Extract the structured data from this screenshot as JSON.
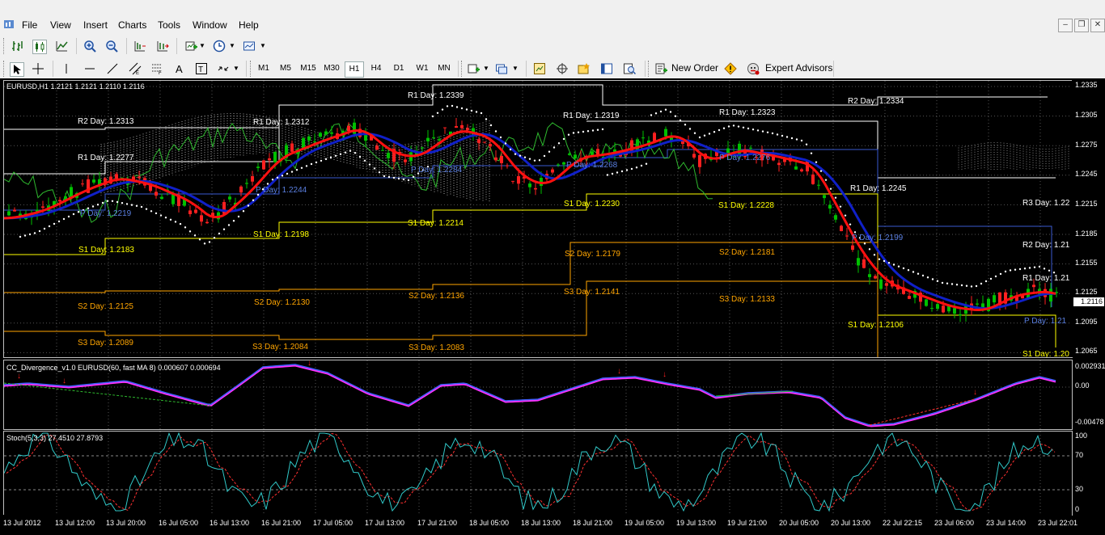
{
  "menu": [
    "File",
    "View",
    "Insert",
    "Charts",
    "Tools",
    "Window",
    "Help"
  ],
  "timeframes": [
    "M1",
    "M5",
    "M15",
    "M30",
    "H1",
    "H4",
    "D1",
    "W1",
    "MN"
  ],
  "active_timeframe": "H1",
  "toolbar": {
    "new_order": "New Order",
    "expert_advisors": "Expert Advisors"
  },
  "main_chart": {
    "title": "EURUSD,H1  1.2121 1.2121 1.2110 1.2116",
    "current_price": "1.2116",
    "axis_ticks": [
      "1.2335",
      "1.2305",
      "1.2275",
      "1.2245",
      "1.2215",
      "1.2185",
      "1.2155",
      "1.2125",
      "1.2095",
      "1.2065"
    ],
    "pivot_labels": [
      {
        "text": "R1 Day: 1.2339",
        "color": "#ffffff"
      },
      {
        "text": "R2 Day: 1.2313",
        "color": "#ffffff"
      },
      {
        "text": "R1 Day: 1.2312",
        "color": "#ffffff"
      },
      {
        "text": "R1 Day: 1.2319",
        "color": "#ffffff"
      },
      {
        "text": "R1 Day: 1.2323",
        "color": "#ffffff"
      },
      {
        "text": "R2 Day: 1.2334",
        "color": "#ffffff"
      },
      {
        "text": "R1 Day: 1.2277",
        "color": "#ffffff"
      },
      {
        "text": "P Day: 1.2284",
        "color": "#5a7fe0"
      },
      {
        "text": "P Day: 1.2268",
        "color": "#5a7fe0"
      },
      {
        "text": "P Day: 1.2276",
        "color": "#5a7fe0"
      },
      {
        "text": "P Day: 1.2244",
        "color": "#5a7fe0"
      },
      {
        "text": "R1 Day: 1.2245",
        "color": "#ffffff"
      },
      {
        "text": "R3 Day: 1.22",
        "color": "#ffffff"
      },
      {
        "text": "P Day: 1.2219",
        "color": "#5a7fe0"
      },
      {
        "text": "S1 Day: 1.2230",
        "color": "#ffff00"
      },
      {
        "text": "S1 Day: 1.2228",
        "color": "#ffff00"
      },
      {
        "text": "S1 Day: 1.2214",
        "color": "#ffff00"
      },
      {
        "text": "S1 Day: 1.2198",
        "color": "#ffff00"
      },
      {
        "text": "P Day: 1.2199",
        "color": "#5a7fe0"
      },
      {
        "text": "S1 Day: 1.2183",
        "color": "#ffff00"
      },
      {
        "text": "R2 Day: 1.21",
        "color": "#ffffff"
      },
      {
        "text": "S2 Day: 1.2179",
        "color": "#ffa500"
      },
      {
        "text": "S2 Day: 1.2181",
        "color": "#ffa500"
      },
      {
        "text": "R1 Day: 1.21",
        "color": "#ffffff"
      },
      {
        "text": "S2 Day: 1.2136",
        "color": "#ffa500"
      },
      {
        "text": "S3 Day: 1.2141",
        "color": "#ffa500"
      },
      {
        "text": "S3 Day: 1.2133",
        "color": "#ffa500"
      },
      {
        "text": "S2 Day: 1.2130",
        "color": "#ffa500"
      },
      {
        "text": "S2 Day: 1.2125",
        "color": "#ffa500"
      },
      {
        "text": "P Day: 1.21",
        "color": "#5a7fe0"
      },
      {
        "text": "S1 Day: 1.2106",
        "color": "#ffff00"
      },
      {
        "text": "S3 Day: 1.2089",
        "color": "#ffa500"
      },
      {
        "text": "S3 Day: 1.2084",
        "color": "#ffa500"
      },
      {
        "text": "S3 Day: 1.2083",
        "color": "#ffa500"
      },
      {
        "text": "S1 Day: 1.20",
        "color": "#ffff00"
      }
    ]
  },
  "divergence_panel": {
    "title": "CC_Divergence_v1.0 EURUSD(60, fast MA 8) 0.000607 0.000694",
    "axis_ticks": [
      "0.002931",
      "0.00",
      "-0.00478"
    ]
  },
  "stoch_panel": {
    "title": "Stoch(5,3,3) 27.4510 27.8793",
    "axis_ticks": [
      "100",
      "70",
      "30",
      "0"
    ]
  },
  "time_labels": [
    "13 Jul 2012",
    "13 Jul 12:00",
    "13 Jul 20:00",
    "16 Jul 05:00",
    "16 Jul 13:00",
    "16 Jul 21:00",
    "17 Jul 05:00",
    "17 Jul 13:00",
    "17 Jul 21:00",
    "18 Jul 05:00",
    "18 Jul 13:00",
    "18 Jul 21:00",
    "19 Jul 05:00",
    "19 Jul 13:00",
    "19 Jul 21:00",
    "20 Jul 05:00",
    "20 Jul 13:00",
    "22 Jul 22:15",
    "23 Jul 06:00",
    "23 Jul 14:00",
    "23 Jul 22:01"
  ],
  "colors": {
    "background": "#000000",
    "bull": "#00c000",
    "bear": "#ff0000",
    "ma_fast": "#ff0000",
    "ma_slow": "#0000cc",
    "psar": "#ffffff"
  }
}
